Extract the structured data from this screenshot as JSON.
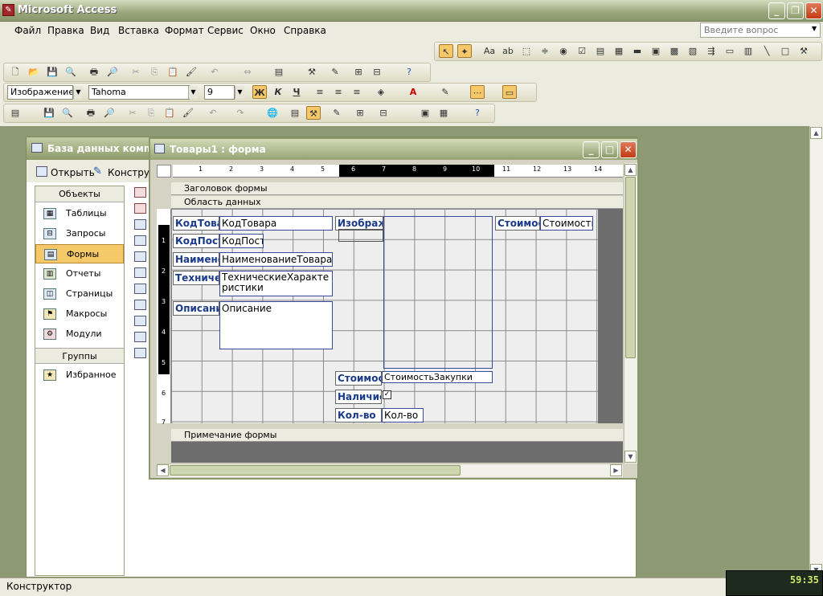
{
  "app": {
    "title": "Microsoft Access",
    "icon": "access-key-icon"
  },
  "menu": {
    "items": [
      "Файл",
      "Правка",
      "Вид",
      "Вставка",
      "Формат",
      "Сервис",
      "Окно",
      "Справка"
    ],
    "help_placeholder": "Введите вопрос"
  },
  "format_toolbar": {
    "object": "Изображение_",
    "font": "Tahoma",
    "size": "9",
    "bold": "Ж",
    "italic": "К",
    "underline": "Ч"
  },
  "db_window": {
    "title": "База данных компь",
    "open_label": "Открыть",
    "design_label": "Конструк",
    "objects_header": "Объекты",
    "objects": [
      "Таблицы",
      "Запросы",
      "Формы",
      "Отчеты",
      "Страницы",
      "Макросы",
      "Модули"
    ],
    "selected": "Формы",
    "groups_header": "Группы",
    "groups": [
      "Избранное"
    ]
  },
  "form_window": {
    "title": "Товары1 : форма",
    "sections": {
      "header": "Заголовок формы",
      "detail": "Область данных",
      "footer": "Примечание формы"
    },
    "ruler_h": [
      "1",
      "2",
      "3",
      "4",
      "5",
      "6",
      "7",
      "8",
      "9",
      "10",
      "11",
      "12",
      "13",
      "14"
    ],
    "ruler_v": [
      "1",
      "2",
      "3",
      "4",
      "5",
      "6",
      "7"
    ],
    "controls": {
      "lbl_kod": "КодТова",
      "fld_kod": "КодТовара",
      "lbl_kodpost": "КодПост",
      "fld_kodpost": "КодПост.",
      "lbl_name": "Наимено",
      "fld_name": "НаименованиеТовара",
      "lbl_tech": "Техничес",
      "fld_tech": "ТехническиеХарактеристики",
      "lbl_desc": "Описани",
      "fld_desc": "Описание",
      "lbl_image": "Изображ",
      "lbl_cost": "Стоимос",
      "fld_cost": "Стоимосты",
      "lbl_cost2": "Стоимос",
      "fld_cost2": "СтоимостьЗакупки",
      "lbl_avail": "Наличие",
      "lbl_qty": "Кол-во",
      "fld_qty": "Кол-во"
    }
  },
  "status": {
    "text": "Конструктор"
  },
  "clock": {
    "time": "59:35"
  }
}
